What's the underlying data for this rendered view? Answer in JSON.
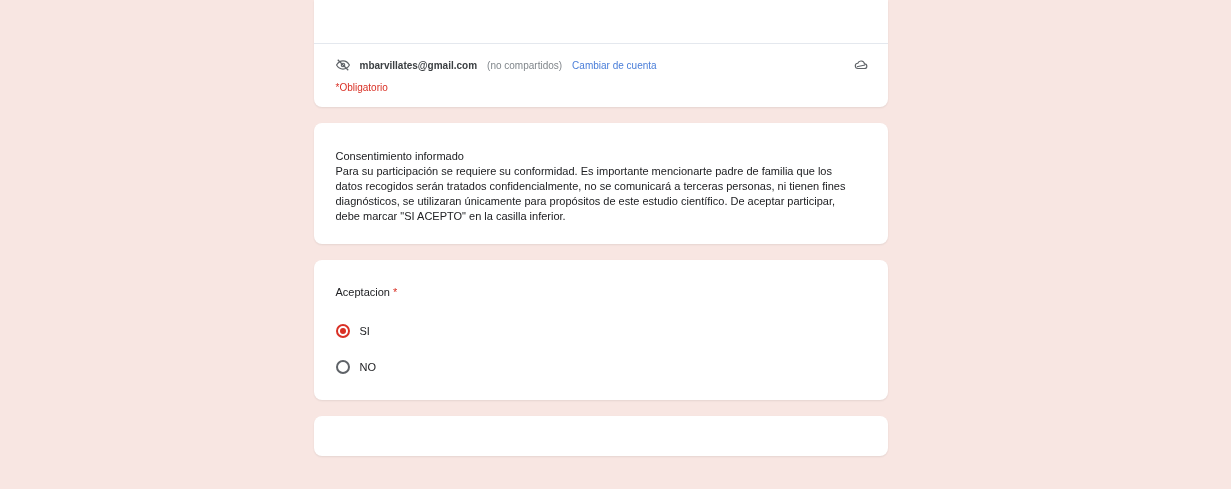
{
  "account": {
    "email": "mbarvillates@gmail.com",
    "note": "(no compartidos)",
    "switch_link": "Cambiar de cuenta",
    "required_note": "*Obligatorio"
  },
  "consent": {
    "title": "Consentimiento informado",
    "body": "Para su participación se requiere su conformidad. Es importante mencionarte padre de familia que los datos recogidos serán tratados confidencialmente, no se comunicará a terceras personas, ni tienen fines diagnósticos,  se utilizaran únicamente para propósitos de este estudio científico. De aceptar participar, debe marcar \"SI ACEPTO\" en la casilla inferior."
  },
  "question": {
    "label": "Aceptacion",
    "required_mark": "*",
    "options": [
      {
        "label": "SI",
        "selected": true
      },
      {
        "label": "NO",
        "selected": false
      }
    ]
  }
}
